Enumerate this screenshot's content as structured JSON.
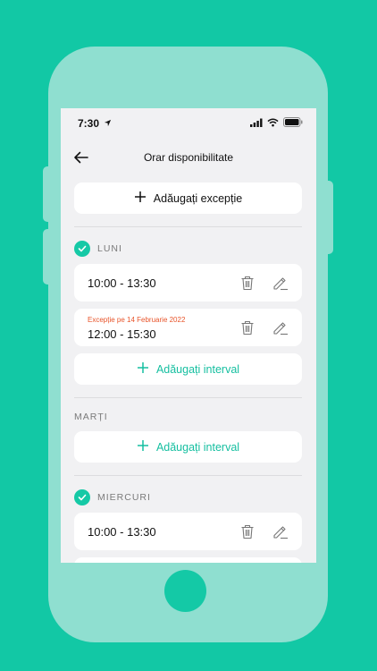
{
  "status_bar": {
    "time": "7:30"
  },
  "nav": {
    "title": "Orar disponibilitate"
  },
  "add_exception_label": "Adăugați excepție",
  "add_interval_label": "Adăugați interval",
  "days": {
    "luni": {
      "label": "LUNI",
      "checked": true,
      "intervals": [
        {
          "time": "10:00 - 13:30"
        },
        {
          "exception": "Excepție pe 14 Februarie 2022",
          "time": "12:00 - 15:30"
        }
      ]
    },
    "marti": {
      "label": "MARȚI",
      "checked": false
    },
    "miercuri": {
      "label": "MIERCURI",
      "checked": true,
      "intervals": [
        {
          "time": "10:00 - 13:30"
        }
      ]
    }
  },
  "colors": {
    "accent": "#15c9a6",
    "exception": "#e8542a",
    "background": "#12c8a5"
  }
}
